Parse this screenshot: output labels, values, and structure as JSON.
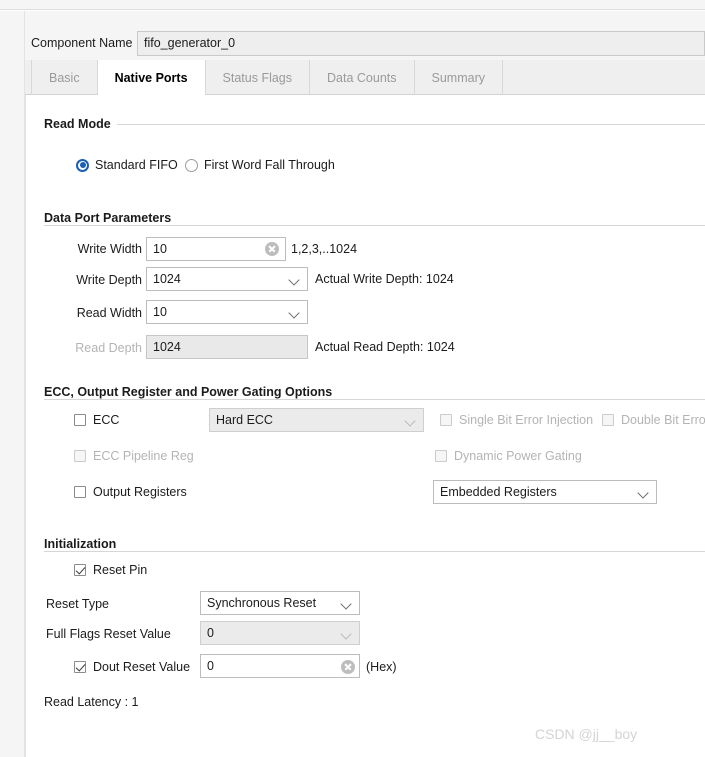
{
  "window": {
    "component_name_label": "Component Name",
    "component_name_value": "fifo_generator_0"
  },
  "tabs": [
    {
      "label": "Basic",
      "active": false
    },
    {
      "label": "Native Ports",
      "active": true
    },
    {
      "label": "Status Flags",
      "active": false
    },
    {
      "label": "Data Counts",
      "active": false
    },
    {
      "label": "Summary",
      "active": false
    }
  ],
  "read_mode": {
    "section_title": "Read Mode",
    "options": [
      {
        "label": "Standard FIFO",
        "selected": true
      },
      {
        "label": "First Word Fall Through",
        "selected": false
      }
    ]
  },
  "data_port_parameters": {
    "section_title": "Data Port Parameters",
    "write_width": {
      "label": "Write Width",
      "value": "10",
      "hint": "1,2,3,..1024"
    },
    "write_depth": {
      "label": "Write Depth",
      "value": "1024",
      "hint": "Actual Write Depth: 1024"
    },
    "read_width": {
      "label": "Read Width",
      "value": "10",
      "hint": ""
    },
    "read_depth": {
      "label": "Read Depth",
      "value": "1024",
      "hint": "Actual Read Depth: 1024"
    }
  },
  "ecc_options": {
    "section_title": "ECC, Output Register and Power Gating Options",
    "ecc_checkbox": {
      "label": "ECC",
      "checked": false,
      "enabled": true
    },
    "ecc_mode_select": {
      "value": "Hard ECC",
      "enabled": false
    },
    "single_bit_error_injection": {
      "label": "Single Bit Error Injection",
      "checked": false,
      "enabled": false
    },
    "double_bit_error_injection": {
      "label": "Double Bit Error",
      "checked": false,
      "enabled": false
    },
    "ecc_pipeline_reg": {
      "label": "ECC Pipeline Reg",
      "checked": false,
      "enabled": false
    },
    "dynamic_power_gating": {
      "label": "Dynamic Power Gating",
      "checked": false,
      "enabled": false
    },
    "output_registers": {
      "label": "Output Registers",
      "checked": false,
      "enabled": true
    },
    "output_register_select": {
      "value": "Embedded Registers",
      "enabled": true
    }
  },
  "initialization": {
    "section_title": "Initialization",
    "reset_pin": {
      "label": "Reset Pin",
      "checked": true,
      "enabled": true
    },
    "reset_type": {
      "label": "Reset Type",
      "value": "Synchronous Reset",
      "enabled": true
    },
    "full_flags_reset_value": {
      "label": "Full Flags Reset Value",
      "value": "0",
      "enabled": false
    },
    "dout_reset_value": {
      "label": "Dout Reset Value",
      "checked": true,
      "value": "0",
      "suffix": "(Hex)"
    }
  },
  "footer": {
    "read_latency": "Read Latency : 1"
  },
  "watermark": {
    "text": "CSDN @jj__boy"
  },
  "colors": {
    "accent": "#1a5fb4",
    "panel": "#f5f5f5",
    "tabbar": "#efefef",
    "disabled_text": "#b4b4b4",
    "watermark": "#d4d4d4"
  }
}
